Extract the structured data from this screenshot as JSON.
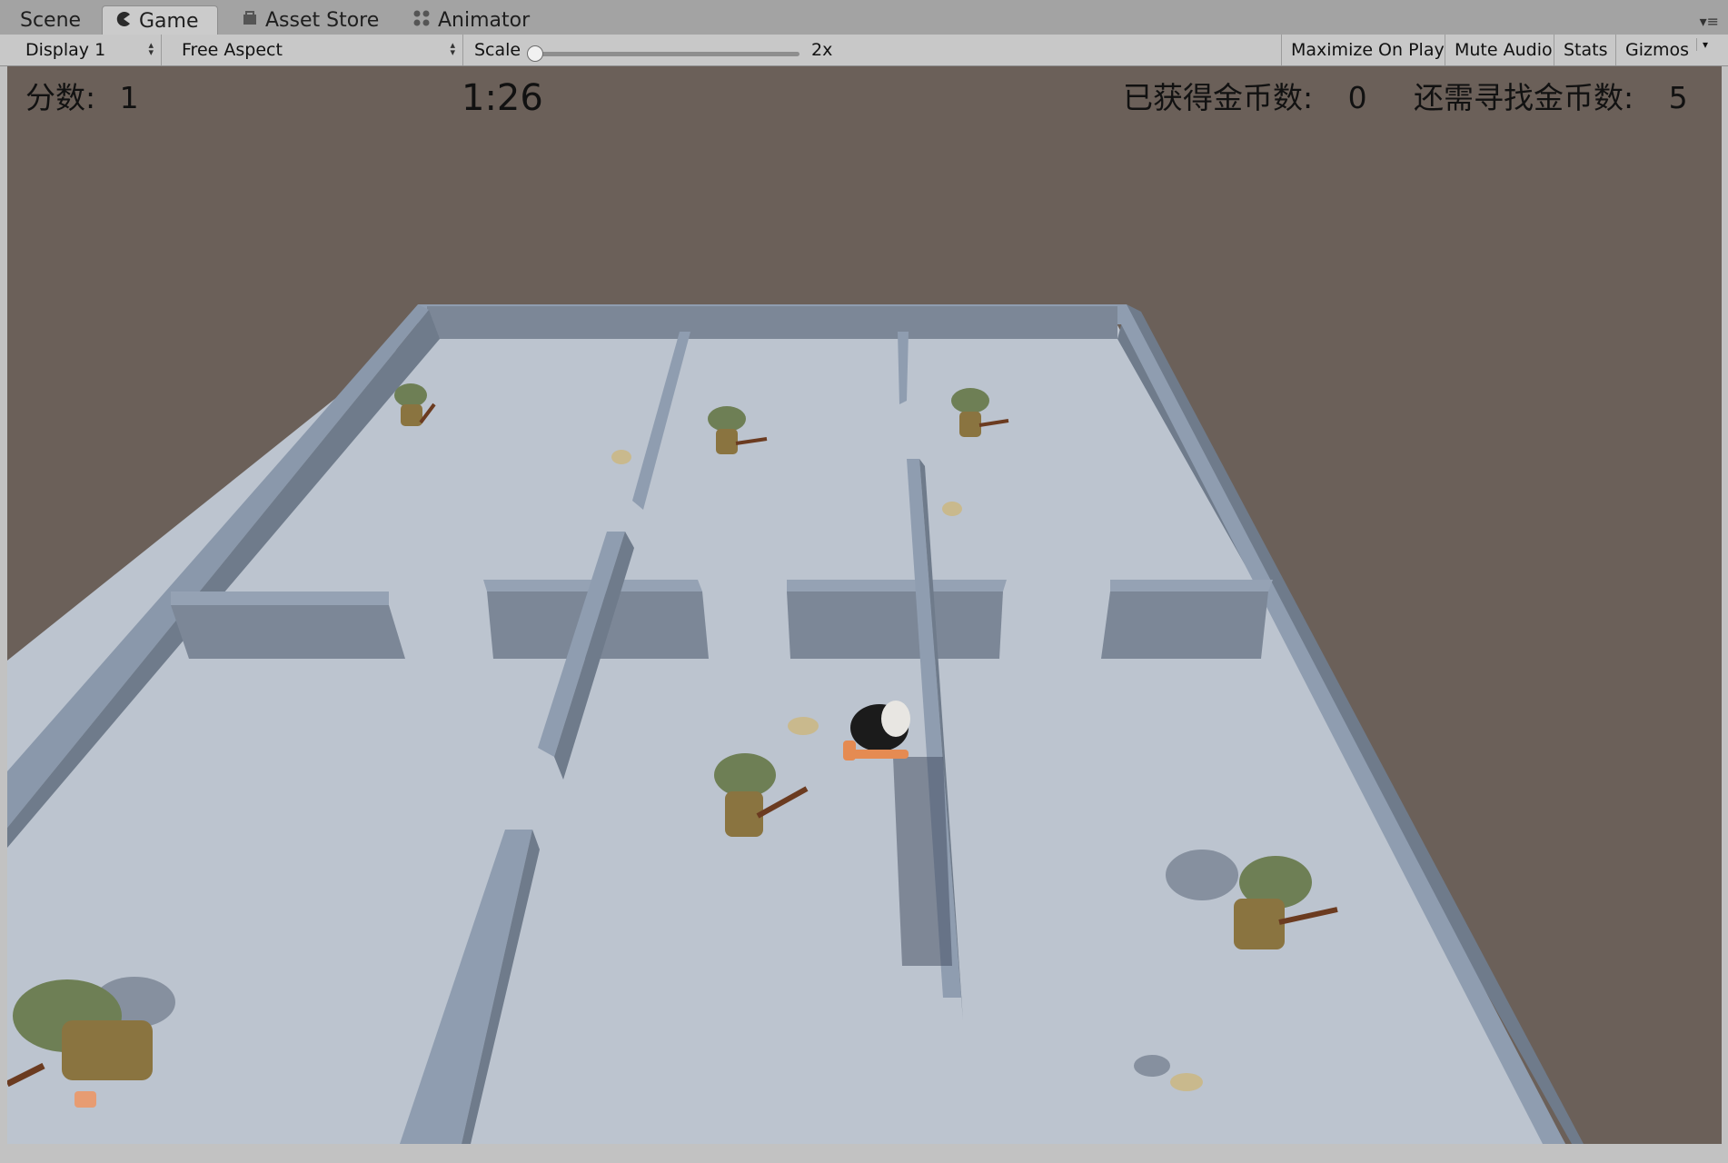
{
  "tabs": [
    {
      "label": "Scene",
      "icon": "",
      "active": false
    },
    {
      "label": "Game",
      "icon": "pacman-icon",
      "active": true
    },
    {
      "label": "Asset Store",
      "icon": "store-bag-icon",
      "active": false
    },
    {
      "label": "Animator",
      "icon": "animator-nodes-icon",
      "active": false
    }
  ],
  "toolbar": {
    "display": "Display 1",
    "aspect": "Free Aspect",
    "scale_label": "Scale",
    "scale_value": "2x",
    "maximize_on_play": "Maximize On Play",
    "mute_audio": "Mute Audio",
    "stats": "Stats",
    "gizmos": "Gizmos"
  },
  "hud": {
    "score_label": "分数:",
    "score_value": "1",
    "timer": "1:26",
    "coins_label": "已获得金币数:",
    "coins_value": "0",
    "remaining_label": "还需寻找金币数:",
    "remaining_value": "5"
  },
  "colors": {
    "sky": "#6b6059",
    "floor": "#bcc4cf",
    "wall_top": "#8f9db0",
    "wall_side": "#6f7b8b",
    "soldier_helmet": "#6e7f55",
    "soldier_body": "#8a7440",
    "coin": "#c9b98d"
  }
}
